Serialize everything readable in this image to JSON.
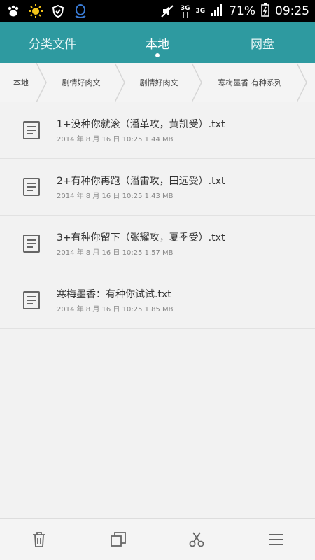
{
  "status": {
    "battery": "71%",
    "time": "09:25",
    "net1": "3G",
    "net2": "3G"
  },
  "tabs": [
    {
      "label": "分类文件"
    },
    {
      "label": "本地"
    },
    {
      "label": "网盘"
    }
  ],
  "breadcrumb": [
    "本地",
    "剧情好肉文",
    "剧情好肉文",
    "寒梅墨香 有种系列"
  ],
  "files": [
    {
      "name": "1+没种你就滚（潘革攻，黄凯受）.txt",
      "info": "2014 年 8 月 16 日 10:25 1.44 MB"
    },
    {
      "name": "2+有种你再跑（潘雷攻，田远受）.txt",
      "info": "2014 年 8 月 16 日 10:25 1.43 MB"
    },
    {
      "name": "3+有种你留下（张耀攻，夏季受）.txt",
      "info": "2014 年 8 月 16 日 10:25 1.57 MB"
    },
    {
      "name": "寒梅墨香：有种你试试.txt",
      "info": "2014 年 8 月 16 日 10:25 1.85 MB"
    }
  ],
  "bottom_actions": [
    "trash-icon",
    "copy-icon",
    "cut-icon",
    "menu-icon"
  ],
  "colors": {
    "header": "#2e9aa0"
  }
}
